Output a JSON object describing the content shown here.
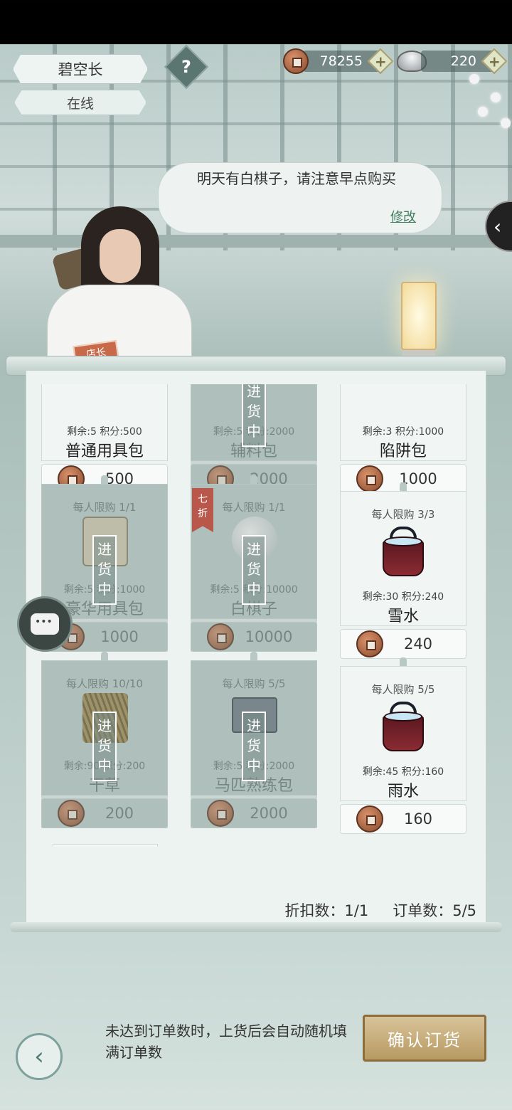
{
  "header": {
    "player_name": "碧空长",
    "status": "在线",
    "help_label": "?",
    "copper_amount": "78255",
    "silver_amount": "220",
    "plus_label": "+"
  },
  "bubble": {
    "message": "明天有白棋子，请注意早点购买",
    "edit_label": "修改"
  },
  "side_tab_label": "‹",
  "shop_tag": "店长",
  "restock_label": "进货中",
  "discount_label": "七折",
  "items": [
    {
      "limit": "",
      "meta": "剩余:5 积分:500",
      "title": "普通用具包",
      "price": "500",
      "grey": false
    },
    {
      "limit": "",
      "meta": "剩余:5 积分:2000",
      "title": "辅料包",
      "price": "2000",
      "grey": true
    },
    {
      "limit": "",
      "meta": "剩余:3 积分:1000",
      "title": "陷阱包",
      "price": "1000",
      "grey": false
    },
    {
      "limit": "每人限购  1/1",
      "meta": "剩余:5 积分:1000",
      "title": "豪华用具包",
      "price": "1000",
      "grey": true
    },
    {
      "limit": "每人限购  1/1",
      "meta": "剩余:5 积分:10000",
      "title": "白棋子",
      "price": "10000",
      "grey": true
    },
    {
      "limit": "每人限购  3/3",
      "meta": "剩余:30 积分:240",
      "title": "雪水",
      "price": "240",
      "grey": false
    },
    {
      "limit": "每人限购  10/10",
      "meta": "剩余:90 积分:200",
      "title": "干草",
      "price": "200",
      "grey": true
    },
    {
      "limit": "每人限购  5/5",
      "meta": "剩余:5 积分:2000",
      "title": "马匹熟练包",
      "price": "2000",
      "grey": true
    },
    {
      "limit": "每人限购  5/5",
      "meta": "剩余:45 积分:160",
      "title": "雨水",
      "price": "160",
      "grey": false
    }
  ],
  "summary": {
    "discount_count": "折扣数：1/1",
    "order_count": "订单数：5/5"
  },
  "footer": {
    "hint": "未达到订单数时，上货后会自动随机填满订单数",
    "confirm_label": "确认订货",
    "back_label": "‹"
  }
}
